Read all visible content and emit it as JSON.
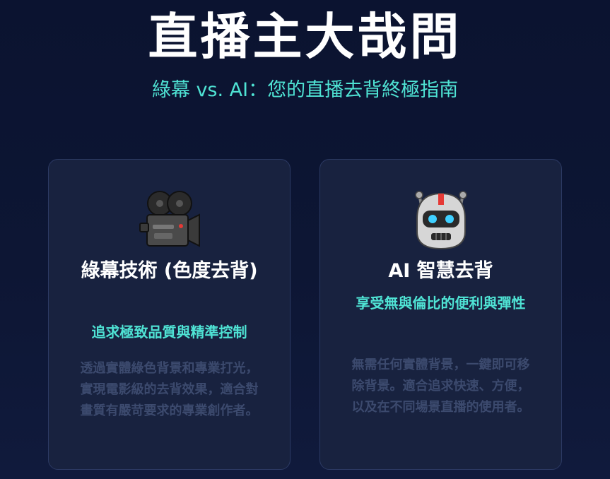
{
  "header": {
    "title": "直播主大哉問",
    "subtitle": "綠幕 vs. AI：您的直播去背終極指南"
  },
  "cards": [
    {
      "icon": "movie-camera-icon",
      "title": "綠幕技術 (色度去背)",
      "subtitle": "追求極致品質與精準控制",
      "description": "透過實體綠色背景和專業打光，實現電影級的去背效果，適合對畫質有嚴苛要求的專業創作者。"
    },
    {
      "icon": "robot-icon",
      "title": "AI 智慧去背",
      "subtitle": "享受無與倫比的便利與彈性",
      "description": "無需任何實體背景，一鍵即可移除背景。適合追求快速、方便，以及在不同場景直播的使用者。"
    }
  ],
  "colors": {
    "background": "#0b1330",
    "card": "#18223f",
    "accent": "#4fe3d4",
    "muted_text": "#3c4a6e"
  }
}
